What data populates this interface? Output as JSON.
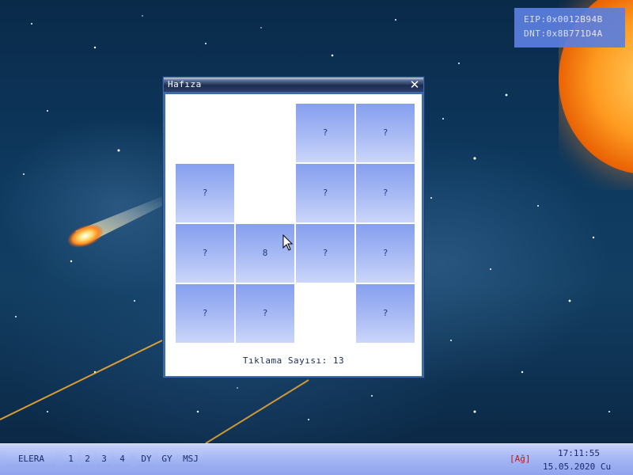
{
  "debug": {
    "eip": "EIP:0x0012B94B",
    "dnt": "DNT:0x8B771D4A"
  },
  "window": {
    "title": "Hafıza",
    "close_icon": "close-x-icon",
    "counter_text": "Tıklama Sayısı: 13",
    "cells": [
      [
        "",
        "",
        "?",
        "?"
      ],
      [
        "?",
        "",
        "?",
        "?"
      ],
      [
        "?",
        "8",
        "?",
        "?"
      ],
      [
        "?",
        "?",
        "",
        "?"
      ]
    ]
  },
  "taskbar": {
    "start_label": "ELERA",
    "workspaces": [
      "1",
      "2",
      "3",
      "4"
    ],
    "apps": [
      "DY",
      "GY",
      "MSJ"
    ],
    "net_status": "[Ağ]",
    "time": "17:11:55",
    "date": "15.05.2020 Cu"
  },
  "colors": {
    "tile_top": "#86a0f0",
    "tile_bottom": "#cbd6fa",
    "taskbar": "#a8b9f5",
    "net_status": "#c01818",
    "sun": "#ff9a20"
  }
}
